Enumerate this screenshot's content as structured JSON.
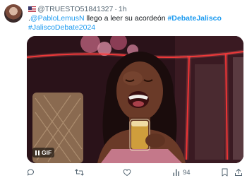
{
  "tweet": {
    "handle": "@TRUESTO51841327",
    "separator": "·",
    "time": "1h",
    "text": {
      "prefix": ".",
      "mention": "@PabloLemusN",
      "body": " llego a leer su acordeón ",
      "hashtag1": "#DebateJalisco",
      "hashtag2": "#JaliscoDebate2024"
    },
    "media": {
      "badge": "GIF"
    },
    "actions": {
      "views": "94"
    }
  },
  "colors": {
    "link": "#1d9bf0",
    "secondary_text": "#536471",
    "primary_text": "#0f1419"
  },
  "icons": [
    "flag-icon",
    "pause-icon",
    "reply-icon",
    "retweet-icon",
    "like-icon",
    "views-icon",
    "bookmark-icon",
    "share-icon"
  ]
}
